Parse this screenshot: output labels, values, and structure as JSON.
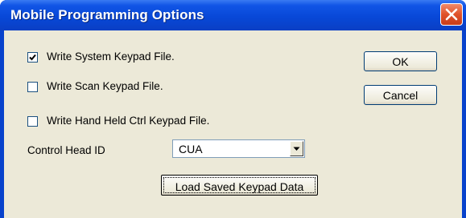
{
  "window": {
    "title": "Mobile Programming Options"
  },
  "options": [
    {
      "label": "Write System Keypad File.",
      "checked": true
    },
    {
      "label": "Write Scan Keypad File.",
      "checked": false
    },
    {
      "label": "Write Hand Held Ctrl Keypad File.",
      "checked": false
    }
  ],
  "control_head": {
    "label": "Control Head ID",
    "value": "CUA"
  },
  "buttons": {
    "ok": "OK",
    "cancel": "Cancel",
    "load": "Load Saved Keypad Data"
  },
  "icons": {
    "close": "close-icon",
    "check": "checkmark-icon",
    "dropdown": "chevron-down-icon"
  },
  "colors": {
    "titlebar": "#0848d8",
    "client": "#ece9d8",
    "close": "#e0522a"
  }
}
